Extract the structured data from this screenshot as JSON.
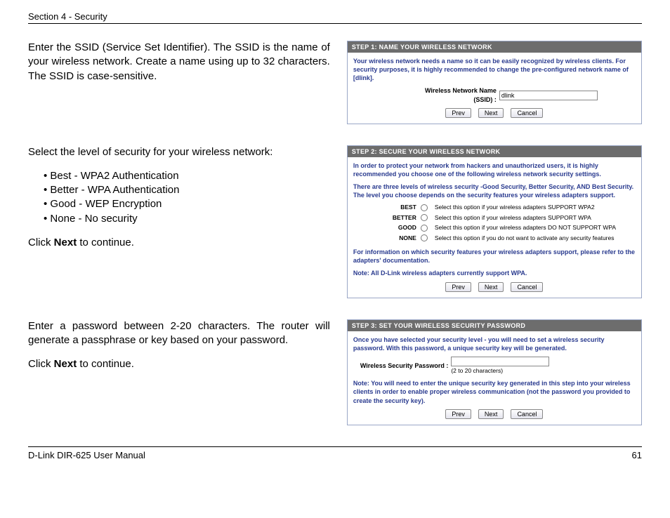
{
  "header": {
    "section": "Section 4 - Security"
  },
  "footer": {
    "manual": "D-Link DIR-625 User Manual",
    "page": "61"
  },
  "step1": {
    "instruction": "Enter the SSID (Service Set Identifier). The SSID is the name of your wireless network. Create a name using up to 32 characters. The SSID is case-sensitive.",
    "title": "STEP 1: NAME YOUR WIRELESS NETWORK",
    "desc": "Your wireless network needs a name so it can be easily recognized by wireless clients. For security purposes, it is highly recommended to change the pre-configured network name of [dlink].",
    "field_label_line1": "Wireless Network Name",
    "field_label_line2": "(SSID) :",
    "field_value": "dlink",
    "buttons": {
      "prev": "Prev",
      "next": "Next",
      "cancel": "Cancel"
    }
  },
  "step2": {
    "intro": "Select the level of security for your wireless network:",
    "bullets": [
      "Best - WPA2 Authentication",
      "Better - WPA Authentication",
      "Good - WEP Encryption",
      "None - No security"
    ],
    "click_prefix": "Click ",
    "click_bold": "Next",
    "click_suffix": " to continue.",
    "title": "STEP 2: SECURE YOUR WIRELESS NETWORK",
    "desc1": "In order to protect your network from hackers and unauthorized users, it is highly recommended you choose one of the following wireless network security settings.",
    "desc2": "There are three levels of wireless security -Good Security, Better Security, AND Best Security. The level you choose depends on the security features your wireless adapters support.",
    "options": {
      "best": {
        "label": "BEST",
        "desc": "Select this option if your wireless adapters SUPPORT WPA2"
      },
      "better": {
        "label": "BETTER",
        "desc": "Select this option if your wireless adapters SUPPORT WPA"
      },
      "good": {
        "label": "GOOD",
        "desc": "Select this option if your wireless adapters DO NOT SUPPORT WPA"
      },
      "none": {
        "label": "NONE",
        "desc": "Select this option if you do not want to activate any security features"
      }
    },
    "note1": "For information on which security features your wireless adapters support, please refer to the adapters' documentation.",
    "note2": "Note: All D-Link wireless adapters currently support WPA.",
    "buttons": {
      "prev": "Prev",
      "next": "Next",
      "cancel": "Cancel"
    }
  },
  "step3": {
    "instruction": "Enter a password between 2-20 characters. The router will generate a passphrase or key based on your password.",
    "click_prefix": "Click ",
    "click_bold": "Next",
    "click_suffix": " to continue.",
    "title": "STEP 3: SET YOUR WIRELESS SECURITY PASSWORD",
    "desc": "Once you have selected your security level - you will need to set a wireless security password. With this password, a unique security key will be generated.",
    "field_label": "Wireless Security Password :",
    "hint": "(2 to 20 characters)",
    "note": "Note: You will need to enter the unique security key generated in this step into your wireless clients in order to enable proper wireless communication (not the password you provided to create the security key).",
    "buttons": {
      "prev": "Prev",
      "next": "Next",
      "cancel": "Cancel"
    }
  }
}
